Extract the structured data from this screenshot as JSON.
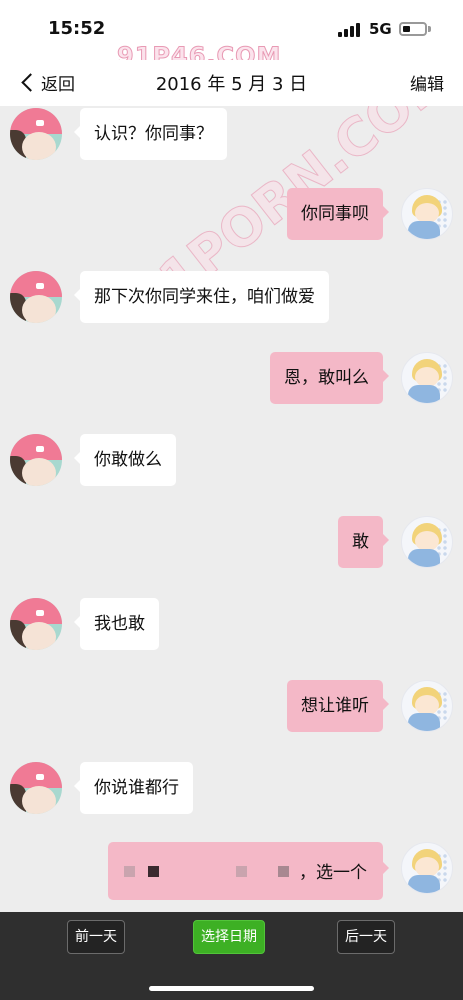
{
  "status_bar": {
    "time": "15:52",
    "network": "5G",
    "watermark": "91P46.COM"
  },
  "header": {
    "back_label": "返回",
    "title": "2016 年 5 月 3 日",
    "edit_label": "编辑"
  },
  "chat_watermark": "91PORN.COM",
  "messages": [
    {
      "side": "in",
      "text": "认识？你同事？"
    },
    {
      "side": "out",
      "text": "你同事呗"
    },
    {
      "side": "in",
      "text": "那下次你同学来住，咱们做爱"
    },
    {
      "side": "out",
      "text": "恩，敢叫么"
    },
    {
      "side": "in",
      "text": "你敢做么"
    },
    {
      "side": "out",
      "text": "敢"
    },
    {
      "side": "in",
      "text": "我也敢"
    },
    {
      "side": "out",
      "text": "想让谁听"
    },
    {
      "side": "in",
      "text": "你说谁都行"
    },
    {
      "side": "out",
      "text": "，选一个",
      "redacted": true
    }
  ],
  "toolbar": {
    "prev_day": "前一天",
    "pick_date": "选择日期",
    "next_day": "后一天"
  },
  "colors": {
    "chat_bg": "#ededed",
    "incoming_bubble": "#ffffff",
    "outgoing_bubble": "#f4b8c7",
    "accent_green": "#3db024",
    "toolbar_bg": "#2f2f2f"
  },
  "icons": {
    "back": "chevron-left-icon",
    "signal": "cellular-signal-icon",
    "battery": "battery-icon",
    "avatar_in": "girl-pink-hat-avatar",
    "avatar_out": "blonde-boy-avatar"
  }
}
